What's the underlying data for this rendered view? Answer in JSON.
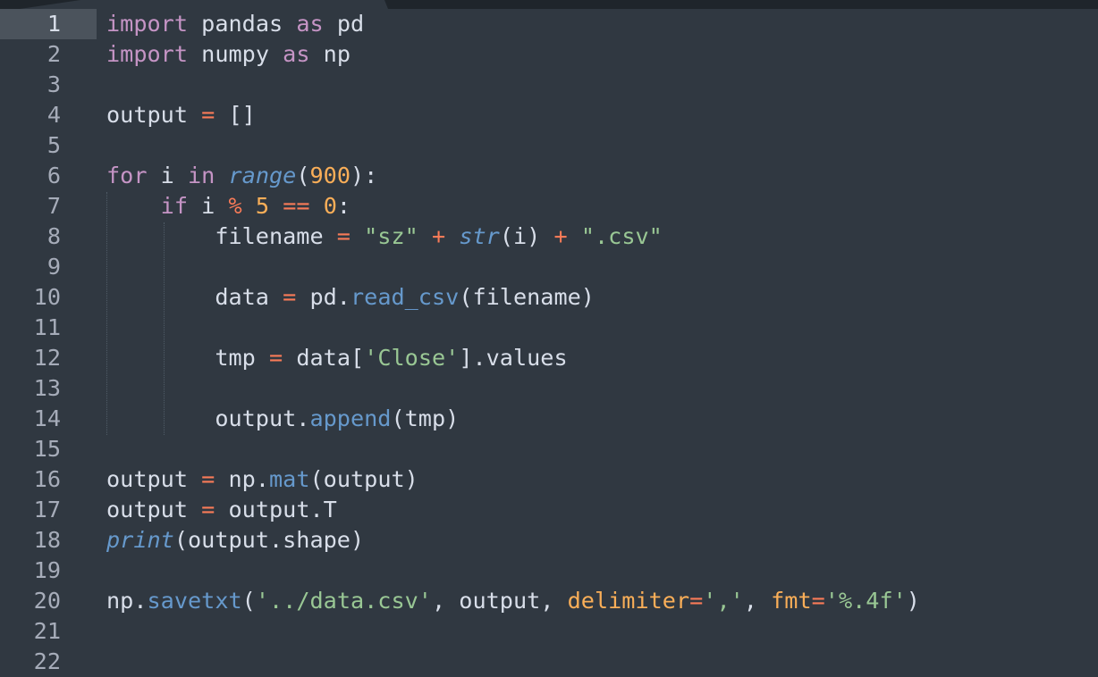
{
  "theme": {
    "background": "#303841",
    "foreground": "#d8dee9",
    "keyword": "#c594c5",
    "operator": "#f97b58",
    "number": "#f9ae58",
    "string": "#99c794",
    "function": "#6699cc",
    "gutter_text": "#a6acb9",
    "active_line_gutter": "#4b535c"
  },
  "editor": {
    "active_line": 1,
    "line_numbers": [
      "1",
      "2",
      "3",
      "4",
      "5",
      "6",
      "7",
      "8",
      "9",
      "10",
      "11",
      "12",
      "13",
      "14",
      "15",
      "16",
      "17",
      "18",
      "19",
      "20",
      "21",
      "22"
    ],
    "lines": [
      [
        {
          "t": "import",
          "c": "kw"
        },
        {
          "t": " pandas ",
          "c": "punc"
        },
        {
          "t": "as",
          "c": "kw"
        },
        {
          "t": " pd",
          "c": "punc"
        }
      ],
      [
        {
          "t": "import",
          "c": "kw"
        },
        {
          "t": " numpy ",
          "c": "punc"
        },
        {
          "t": "as",
          "c": "kw"
        },
        {
          "t": " np",
          "c": "punc"
        }
      ],
      [],
      [
        {
          "t": "output ",
          "c": "punc"
        },
        {
          "t": "=",
          "c": "op"
        },
        {
          "t": " []",
          "c": "punc"
        }
      ],
      [],
      [
        {
          "t": "for",
          "c": "kw"
        },
        {
          "t": " i ",
          "c": "punc"
        },
        {
          "t": "in",
          "c": "kw"
        },
        {
          "t": " ",
          "c": "punc"
        },
        {
          "t": "range",
          "c": "fni"
        },
        {
          "t": "(",
          "c": "punc"
        },
        {
          "t": "900",
          "c": "num"
        },
        {
          "t": "):",
          "c": "punc"
        }
      ],
      [
        {
          "t": "    ",
          "c": "punc"
        },
        {
          "t": "if",
          "c": "kw"
        },
        {
          "t": " i ",
          "c": "punc"
        },
        {
          "t": "%",
          "c": "op"
        },
        {
          "t": " ",
          "c": "punc"
        },
        {
          "t": "5",
          "c": "num"
        },
        {
          "t": " ",
          "c": "punc"
        },
        {
          "t": "==",
          "c": "op"
        },
        {
          "t": " ",
          "c": "punc"
        },
        {
          "t": "0",
          "c": "num"
        },
        {
          "t": ":",
          "c": "punc"
        }
      ],
      [
        {
          "t": "        filename ",
          "c": "punc"
        },
        {
          "t": "=",
          "c": "op"
        },
        {
          "t": " ",
          "c": "punc"
        },
        {
          "t": "\"sz\"",
          "c": "str"
        },
        {
          "t": " ",
          "c": "punc"
        },
        {
          "t": "+",
          "c": "op"
        },
        {
          "t": " ",
          "c": "punc"
        },
        {
          "t": "str",
          "c": "fni"
        },
        {
          "t": "(i) ",
          "c": "punc"
        },
        {
          "t": "+",
          "c": "op"
        },
        {
          "t": " ",
          "c": "punc"
        },
        {
          "t": "\".csv\"",
          "c": "str"
        }
      ],
      [],
      [
        {
          "t": "        data ",
          "c": "punc"
        },
        {
          "t": "=",
          "c": "op"
        },
        {
          "t": " pd.",
          "c": "punc"
        },
        {
          "t": "read_csv",
          "c": "fn"
        },
        {
          "t": "(filename)",
          "c": "punc"
        }
      ],
      [],
      [
        {
          "t": "        tmp ",
          "c": "punc"
        },
        {
          "t": "=",
          "c": "op"
        },
        {
          "t": " data[",
          "c": "punc"
        },
        {
          "t": "'Close'",
          "c": "str"
        },
        {
          "t": "].values",
          "c": "punc"
        }
      ],
      [],
      [
        {
          "t": "        output.",
          "c": "punc"
        },
        {
          "t": "append",
          "c": "fn"
        },
        {
          "t": "(tmp)",
          "c": "punc"
        }
      ],
      [],
      [
        {
          "t": "output ",
          "c": "punc"
        },
        {
          "t": "=",
          "c": "op"
        },
        {
          "t": " np.",
          "c": "punc"
        },
        {
          "t": "mat",
          "c": "fn"
        },
        {
          "t": "(output)",
          "c": "punc"
        }
      ],
      [
        {
          "t": "output ",
          "c": "punc"
        },
        {
          "t": "=",
          "c": "op"
        },
        {
          "t": " output.T",
          "c": "punc"
        }
      ],
      [
        {
          "t": "print",
          "c": "fni"
        },
        {
          "t": "(output.shape)",
          "c": "punc"
        }
      ],
      [],
      [
        {
          "t": "np.",
          "c": "punc"
        },
        {
          "t": "savetxt",
          "c": "fn"
        },
        {
          "t": "(",
          "c": "punc"
        },
        {
          "t": "'../data.csv'",
          "c": "str"
        },
        {
          "t": ", output, ",
          "c": "punc"
        },
        {
          "t": "delimiter",
          "c": "param"
        },
        {
          "t": "=",
          "c": "op"
        },
        {
          "t": "','",
          "c": "str"
        },
        {
          "t": ", ",
          "c": "punc"
        },
        {
          "t": "fmt",
          "c": "param"
        },
        {
          "t": "=",
          "c": "op"
        },
        {
          "t": "'%.4f'",
          "c": "str"
        },
        {
          "t": ")",
          "c": "punc"
        }
      ],
      [],
      []
    ]
  }
}
